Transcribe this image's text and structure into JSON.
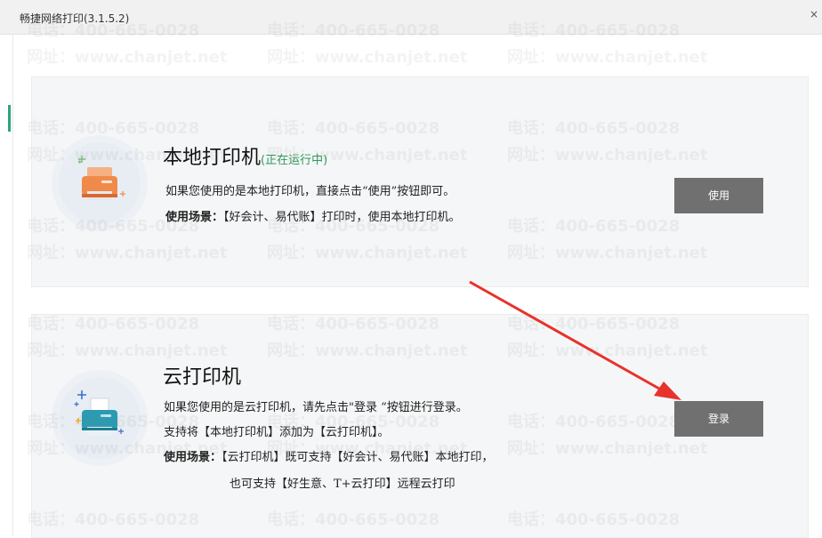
{
  "window": {
    "title": "畅捷网络打印(3.1.5.2)",
    "close_glyph": "×"
  },
  "local_printer": {
    "title": "本地打印机",
    "status": "(正在运行中)",
    "line1": "如果您使用的是本地打印机，直接点击“使用”按钮即可。",
    "scene_label": "使用场景：",
    "scene_text": "【好会计、易代账】打印时，使用本地打印机。",
    "button_label": "使用",
    "icon": "printer-icon"
  },
  "cloud_printer": {
    "title": "云打印机",
    "line1": "如果您使用的是云打印机，请先点击\"登录 “按钮进行登录。",
    "line2": "支持将【本地打印机】添加为【云打印机】。",
    "scene_label": "使用场景：",
    "scene_text": "【云打印机】既可支持【好会计、易代账】本地打印，",
    "line4": "也可支持【好生意、T+云打印】远程云打印",
    "button_label": "登录",
    "icon": "cloud-printer-icon"
  },
  "watermark": {
    "phone": "电话：400-665-0028",
    "site": "网址：www.chanjet.net"
  },
  "colors": {
    "button": "#707070",
    "status": "#2e9a5d",
    "arrow": "#e8322c",
    "card_bg": "#f5f6f7"
  }
}
